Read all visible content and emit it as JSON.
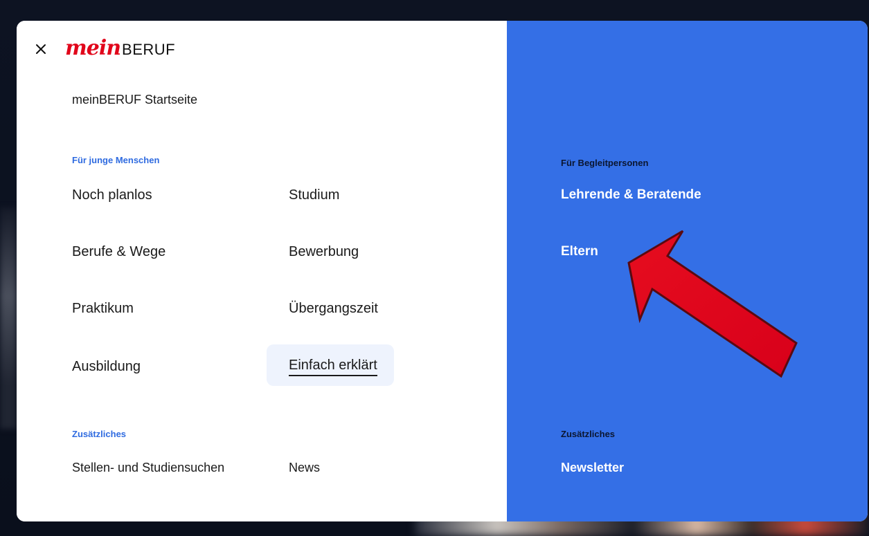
{
  "header": {
    "close_label": "Close",
    "logo_mein": "mein",
    "logo_beruf": "BERUF"
  },
  "main": {
    "home_link": "meinBERUF Startseite",
    "young_people": {
      "label": "Für junge Menschen",
      "col1": [
        "Noch planlos",
        "Berufe & Wege",
        "Praktikum",
        "Ausbildung"
      ],
      "col2": [
        "Studium",
        "Bewerbung",
        "Übergangszeit",
        "Einfach erklärt"
      ]
    },
    "extras": {
      "label": "Zusätzliches",
      "items": [
        "Stellen- und Studiensuchen",
        "News"
      ]
    }
  },
  "right_panel": {
    "companions": {
      "label": "Für Begleitpersonen",
      "items": [
        "Lehrende & Beratende",
        "Eltern"
      ]
    },
    "extras": {
      "label": "Zusätzliches",
      "items": [
        "Newsletter"
      ]
    }
  },
  "colors": {
    "accent_blue": "#346fe6",
    "label_blue": "#2f6be0",
    "brand_red": "#e1061b",
    "arrow_red": "#e0001a"
  },
  "annotation": {
    "arrow_icon": "red-arrow-icon"
  }
}
